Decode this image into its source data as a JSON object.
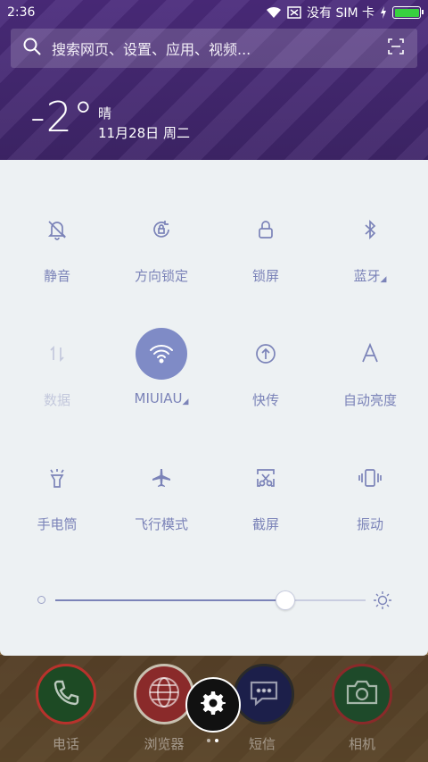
{
  "status_bar": {
    "time": "2:36",
    "carrier": "没有 SIM 卡",
    "icons": [
      "wifi-icon",
      "no-sim-icon",
      "charging-icon",
      "battery-icon"
    ],
    "battery_color": "#38d13f"
  },
  "search": {
    "placeholder": "搜索网页、设置、应用、视频...",
    "icons": [
      "search-icon",
      "scan-icon"
    ]
  },
  "weather": {
    "temp": "-2°",
    "condition": "晴",
    "date": "11月28日 周二"
  },
  "quick_settings": {
    "accent": "#7f8bc6",
    "label_color": "#7b83b8",
    "tiles": [
      {
        "label": "静音",
        "icon": "bell-off-icon",
        "active": false
      },
      {
        "label": "方向锁定",
        "icon": "rotation-lock-icon",
        "active": false
      },
      {
        "label": "锁屏",
        "icon": "lock-icon",
        "active": false
      },
      {
        "label": "蓝牙",
        "icon": "bluetooth-icon",
        "active": false
      },
      {
        "label": "数据",
        "icon": "mobile-data-icon",
        "active": false,
        "disabled": true
      },
      {
        "label": "MIUIAU",
        "icon": "wifi-icon",
        "active": true
      },
      {
        "label": "快传",
        "icon": "quick-transfer-icon",
        "active": false
      },
      {
        "label": "自动亮度",
        "icon": "auto-brightness-icon",
        "active": false
      },
      {
        "label": "手电筒",
        "icon": "flashlight-icon",
        "active": false
      },
      {
        "label": "飞行模式",
        "icon": "airplane-icon",
        "active": false
      },
      {
        "label": "截屏",
        "icon": "screenshot-icon",
        "active": false
      },
      {
        "label": "振动",
        "icon": "vibrate-icon",
        "active": false
      }
    ],
    "brightness": 0.74
  },
  "dock": {
    "apps": [
      {
        "label": "电话",
        "icon": "phone-icon"
      },
      {
        "label": "浏览器",
        "icon": "browser-icon"
      },
      {
        "label": "短信",
        "icon": "message-icon"
      },
      {
        "label": "相机",
        "icon": "camera-icon"
      }
    ],
    "settings_icon": "gear-icon",
    "page_count": 2,
    "current_page": 2
  }
}
